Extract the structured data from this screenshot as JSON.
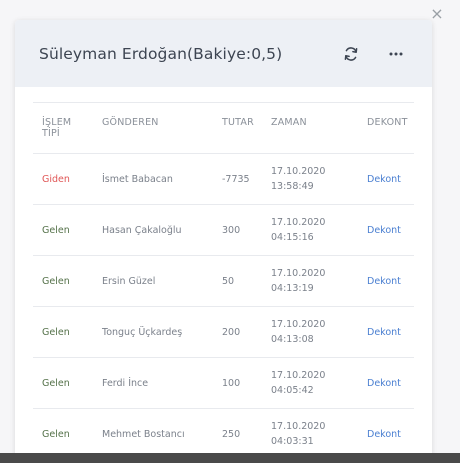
{
  "modal": {
    "title": "Süleyman Erdoğan(Bakiye:0,5)",
    "close_glyph": "×"
  },
  "icons": {
    "close": "close-icon",
    "refresh": "refresh-icon",
    "more": "more-horizontal-icon"
  },
  "colors": {
    "header_bg": "#edf0f5",
    "outgoing": "#e05757",
    "incoming": "#55724a",
    "link": "#4a7fd1"
  },
  "table": {
    "headers": {
      "type_line1": "İŞLEM",
      "type_line2": "TİPİ",
      "sender": "GÖNDEREN",
      "amount": "TUTAR",
      "time": "ZAMAN",
      "receipt": "DEKONT"
    },
    "rows": [
      {
        "type": "Giden",
        "sender": "İsmet Babacan",
        "amount": "-7735",
        "date": "17.10.2020",
        "time": "13:58:49",
        "receipt": "Dekont"
      },
      {
        "type": "Gelen",
        "sender": "Hasan Çakaloğlu",
        "amount": "300",
        "date": "17.10.2020",
        "time": "04:15:16",
        "receipt": "Dekont"
      },
      {
        "type": "Gelen",
        "sender": "Ersin Güzel",
        "amount": "50",
        "date": "17.10.2020",
        "time": "04:13:19",
        "receipt": "Dekont"
      },
      {
        "type": "Gelen",
        "sender": "Tonguç Üçkardeş",
        "amount": "200",
        "date": "17.10.2020",
        "time": "04:13:08",
        "receipt": "Dekont"
      },
      {
        "type": "Gelen",
        "sender": "Ferdi İnce",
        "amount": "100",
        "date": "17.10.2020",
        "time": "04:05:42",
        "receipt": "Dekont"
      },
      {
        "type": "Gelen",
        "sender": "Mehmet Bostancı",
        "amount": "250",
        "date": "17.10.2020",
        "time": "04:03:31",
        "receipt": "Dekont"
      }
    ]
  }
}
